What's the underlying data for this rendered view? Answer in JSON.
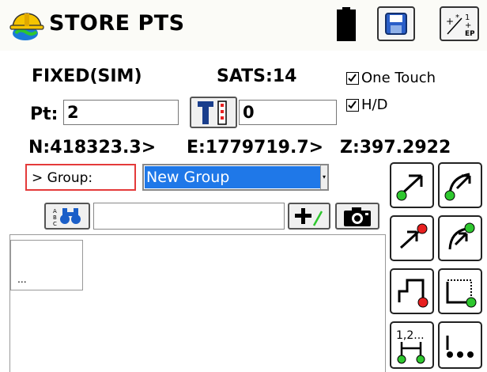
{
  "app": {
    "title": "STORE PTS"
  },
  "titlebar": {
    "icons": [
      "hardhat-globe-icon",
      "battery-icon",
      "save-icon",
      "cogo-calc-icon"
    ]
  },
  "status": {
    "mode": "FIXED(SIM)",
    "sats": "SATS:14",
    "one_touch_label": "One Touch",
    "one_touch_checked": true,
    "hd_label": "H/D",
    "hd_checked": true
  },
  "point": {
    "label": "Pt:",
    "value": "2",
    "rod_height": "0"
  },
  "coords": {
    "n": "N:418323.3>",
    "e": "E:1779719.7>",
    "z": "Z:397.2922"
  },
  "group": {
    "label": "> Group:",
    "selected": "New Group"
  },
  "description": {
    "value": ""
  },
  "panel": {
    "tile_text": "..."
  },
  "colors": {
    "selection": "#1f78e8",
    "highlight_border": "#e43a3a",
    "green_dot": "#2ec72e",
    "red_dot": "#e82020"
  }
}
